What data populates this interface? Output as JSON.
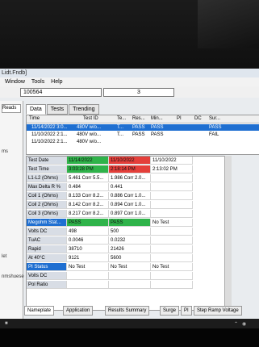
{
  "window": {
    "title": "Lidt.Fndb]"
  },
  "menu": [
    "Window",
    "Tools",
    "Help"
  ],
  "record": {
    "id": "100564",
    "count": "3"
  },
  "left_panel": {
    "tab": "Reads",
    "notes": [
      "ms",
      "let",
      "nmshuese"
    ]
  },
  "tabs": [
    "Data",
    "Tests",
    "Trending"
  ],
  "list": {
    "headers": [
      "Time",
      "Test ID",
      "Te...",
      "Res...",
      "Min...",
      "PI",
      "DC",
      "Sur..."
    ],
    "rows": [
      {
        "time": "11/14/2022 3:0...",
        "test_id": "480V w/o...",
        "te": "T...",
        "res": "PASS",
        "min": "PASS",
        "sur": "PASS",
        "selected": true
      },
      {
        "time": "11/10/2022 2:1...",
        "test_id": "480V w/o...",
        "te": "T...",
        "res": "PASS",
        "min": "PASS",
        "sur": "FAIL",
        "selected": false
      },
      {
        "time": "11/10/2022 2:1...",
        "test_id": "480V w/o...",
        "te": "",
        "res": "",
        "min": "",
        "sur": "",
        "selected": false
      }
    ]
  },
  "grid": {
    "rows": [
      {
        "label": "Test Date",
        "v": [
          "11/14/2022",
          "11/10/2022",
          "11/10/2022"
        ]
      },
      {
        "label": "Test Time",
        "v": [
          "3:03:28 PM",
          "2:18:14 PM",
          "2:13:02 PM"
        ]
      },
      {
        "label": "L1-L2 (Ohms)",
        "v": [
          "5.461 Corr 5.5...",
          "1.986 Corr 2.0...",
          ""
        ]
      },
      {
        "label": "Max Delta R %",
        "v": [
          "0.484",
          "0.441",
          ""
        ]
      },
      {
        "label": "Coil 1 (Ohms)",
        "v": [
          "8.133 Corr 8.2...",
          "0.886 Corr 1.0...",
          ""
        ]
      },
      {
        "label": "Coil 2 (Ohms)",
        "v": [
          "8.142 Corr 8.2...",
          "0.894 Corr 1.0...",
          ""
        ]
      },
      {
        "label": "Coil 3 (Ohms)",
        "v": [
          "8.217 Corr 8.2...",
          "0.897 Corr 1.0...",
          ""
        ]
      },
      {
        "label": "Megohm Stat...",
        "v": [
          "PASS",
          "PASS",
          "No Test"
        ]
      },
      {
        "label": "Volts DC",
        "v": [
          "498",
          "500",
          ""
        ]
      },
      {
        "label": "TuAC",
        "v": [
          "0.0046",
          "0.0232",
          ""
        ]
      },
      {
        "label": "Rapid",
        "v": [
          "38710",
          "21426",
          ""
        ]
      },
      {
        "label": "At 40°C",
        "v": [
          "9121",
          "5600",
          ""
        ]
      },
      {
        "label": "PI Status",
        "v": [
          "No Test",
          "No Test",
          "No Test"
        ]
      },
      {
        "label": "Volts DC",
        "v": [
          "",
          "",
          ""
        ]
      },
      {
        "label": "Pol Ratio",
        "v": [
          "",
          "",
          ""
        ]
      }
    ]
  },
  "bottom_tabs": [
    "Nameplate",
    "Application",
    "Results Summary",
    "Surge",
    "PI",
    "Step Ramp Voltage"
  ],
  "colors": {
    "pass": "#2fb34a",
    "fail": "#e43f3a",
    "selection": "#1f6fd1"
  }
}
